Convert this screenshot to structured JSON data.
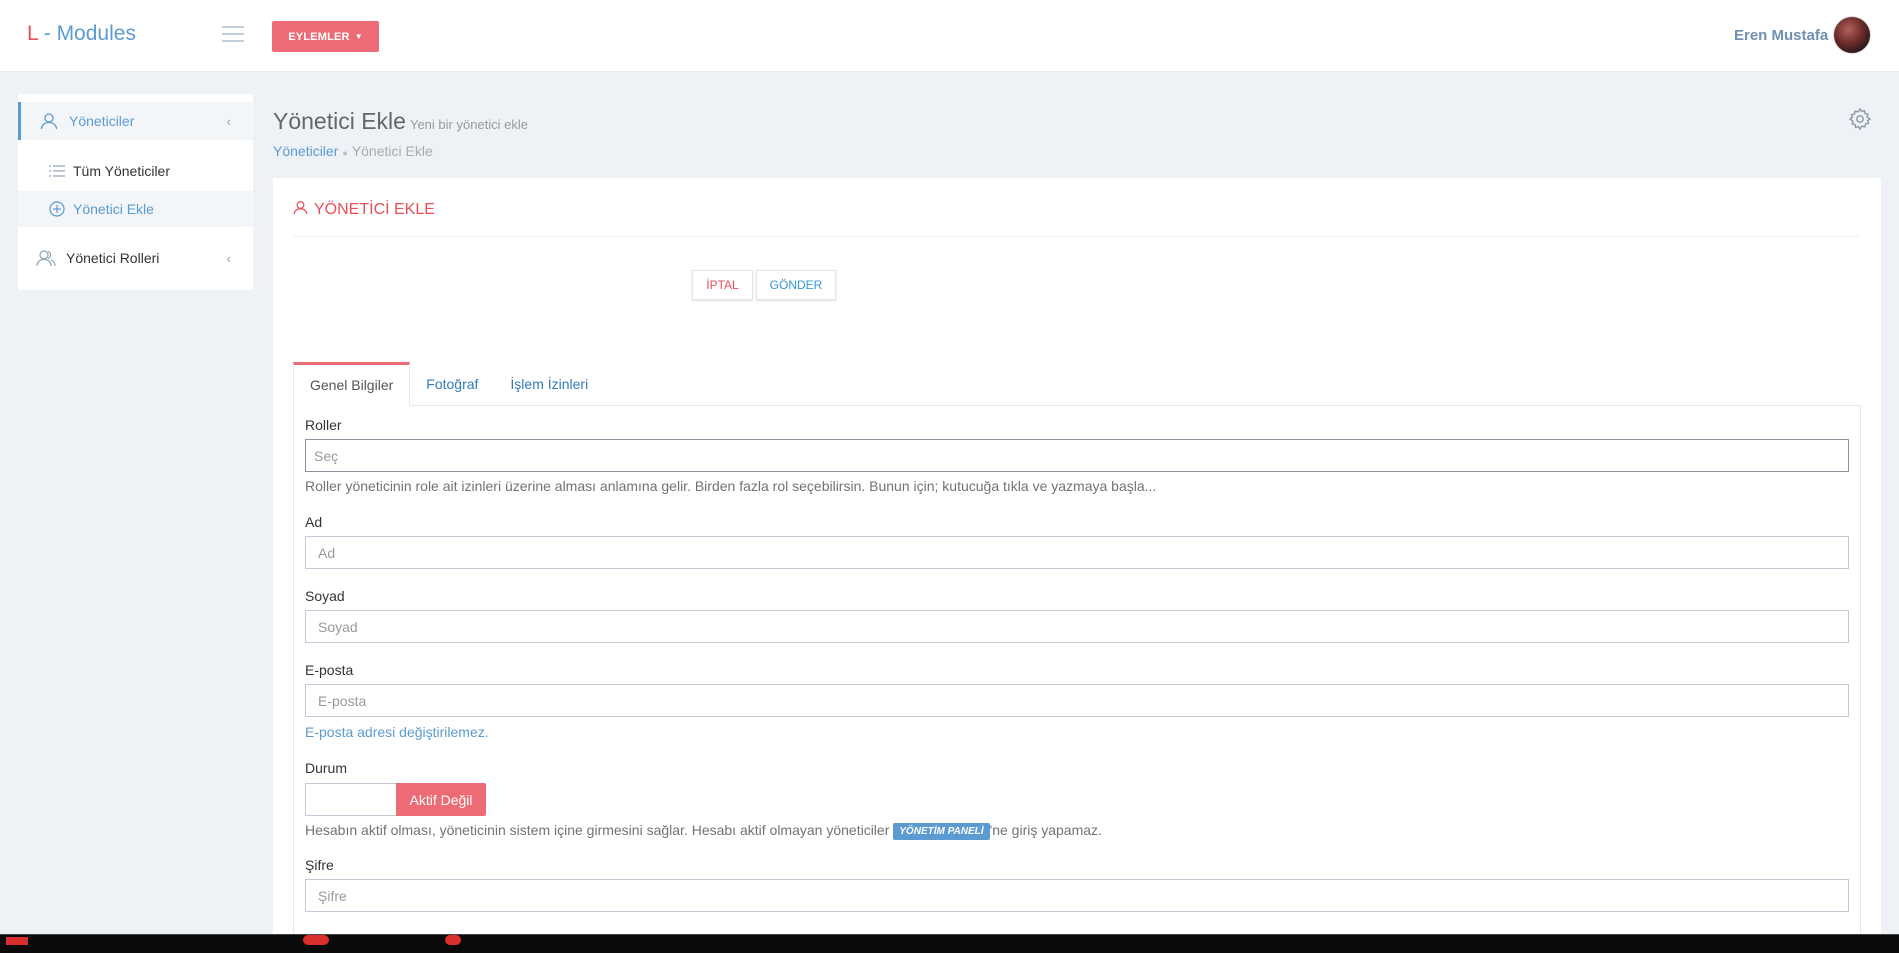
{
  "header": {
    "logo_prefix": "L",
    "logo_text": " - Modules",
    "actions_label": "EYLEMLER",
    "user_name": "Eren Mustafa"
  },
  "sidebar": {
    "items": [
      {
        "label": "Yöneticiler",
        "icon": "user-icon"
      },
      {
        "label": "Yönetici Rolleri",
        "icon": "users-icon"
      }
    ],
    "subitems": [
      {
        "label": "Tüm Yöneticiler",
        "icon": "list-icon"
      },
      {
        "label": "Yönetici Ekle",
        "icon": "plus-circle-icon"
      }
    ]
  },
  "page": {
    "title": "Yönetici Ekle",
    "subtitle": "Yeni bir yönetici ekle",
    "breadcrumb": [
      "Yöneticiler",
      "Yönetici Ekle"
    ]
  },
  "portlet": {
    "title": "YÖNETİCİ EKLE",
    "cancel_label": "İPTAL",
    "submit_label": "GÖNDER"
  },
  "tabs": [
    "Genel Bilgiler",
    "Fotoğraf",
    "İşlem İzinleri"
  ],
  "form": {
    "roles_label": "Roller",
    "roles_placeholder": "Seç",
    "roles_help": "Roller yöneticinin role ait izinleri üzerine alması anlamına gelir. Birden fazla rol seçebilirsin. Bunun için; kutucuğa tıkla ve yazmaya başla...",
    "name_label": "Ad",
    "name_placeholder": "Ad",
    "surname_label": "Soyad",
    "surname_placeholder": "Soyad",
    "email_label": "E-posta",
    "email_placeholder": "E-posta",
    "email_help": "E-posta adresi değiştirilemez.",
    "status_label": "Durum",
    "status_value": "Aktif Değil",
    "status_help_before": "Hesabın aktif olması, yöneticinin sistem içine girmesini sağlar. Hesabı aktif olmayan yöneticiler ",
    "status_help_badge": "YÖNETİM PANELİ",
    "status_help_after": "'ne giriş yapamaz.",
    "password_label": "Şifre",
    "password_placeholder": "Şifre"
  },
  "colors": {
    "accent_red": "#ed6b75",
    "title_red": "#e7505a",
    "link_blue": "#5b9bd1",
    "badge_blue": "#5b9bd1"
  }
}
